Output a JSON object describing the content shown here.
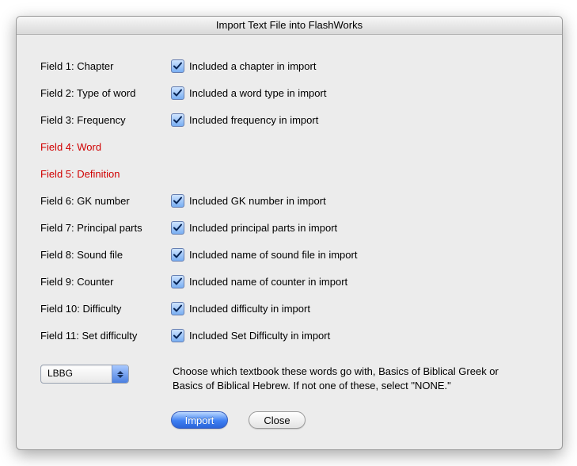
{
  "title": "Import Text File into FlashWorks",
  "fields": [
    {
      "label": "Field 1: Chapter",
      "hasCheckbox": true,
      "checked": true,
      "checkLabel": "Included a chapter in import"
    },
    {
      "label": "Field 2: Type of word",
      "hasCheckbox": true,
      "checked": true,
      "checkLabel": "Included a word type in import"
    },
    {
      "label": "Field 3: Frequency",
      "hasCheckbox": true,
      "checked": true,
      "checkLabel": "Included frequency in import"
    },
    {
      "label": "Field 4: Word",
      "hasCheckbox": false,
      "red": true
    },
    {
      "label": "Field 5: Definition",
      "hasCheckbox": false,
      "red": true
    },
    {
      "label": "Field 6: GK number",
      "hasCheckbox": true,
      "checked": true,
      "checkLabel": "Included GK number in import"
    },
    {
      "label": "Field 7: Principal parts",
      "hasCheckbox": true,
      "checked": true,
      "checkLabel": "Included principal parts in import"
    },
    {
      "label": "Field 8: Sound file",
      "hasCheckbox": true,
      "checked": true,
      "checkLabel": "Included name of sound file in import"
    },
    {
      "label": "Field 9: Counter",
      "hasCheckbox": true,
      "checked": true,
      "checkLabel": "Included name of counter in import"
    },
    {
      "label": "Field 10: Difficulty",
      "hasCheckbox": true,
      "checked": true,
      "checkLabel": "Included difficulty in import"
    },
    {
      "label": "Field 11: Set difficulty",
      "hasCheckbox": true,
      "checked": true,
      "checkLabel": "Included Set Difficulty in import"
    }
  ],
  "textbook_select": {
    "value": "LBBG"
  },
  "help_text": "Choose which textbook these words go with, Basics of Biblical Greek or Basics of Biblical Hebrew. If not one of these, select \"NONE.\"",
  "buttons": {
    "import": "Import",
    "close": "Close"
  }
}
